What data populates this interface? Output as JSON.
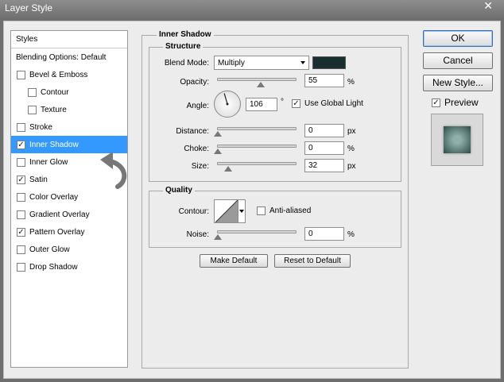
{
  "window": {
    "title": "Layer Style",
    "close_glyph": "✕"
  },
  "styles_panel": {
    "header": "Styles",
    "items": [
      {
        "label": "Blending Options: Default",
        "has_checkbox": false,
        "checked": false,
        "indent": false,
        "selected": false
      },
      {
        "label": "Bevel & Emboss",
        "has_checkbox": true,
        "checked": false,
        "indent": false,
        "selected": false
      },
      {
        "label": "Contour",
        "has_checkbox": true,
        "checked": false,
        "indent": true,
        "selected": false
      },
      {
        "label": "Texture",
        "has_checkbox": true,
        "checked": false,
        "indent": true,
        "selected": false
      },
      {
        "label": "Stroke",
        "has_checkbox": true,
        "checked": false,
        "indent": false,
        "selected": false
      },
      {
        "label": "Inner Shadow",
        "has_checkbox": true,
        "checked": true,
        "indent": false,
        "selected": true
      },
      {
        "label": "Inner Glow",
        "has_checkbox": true,
        "checked": false,
        "indent": false,
        "selected": false
      },
      {
        "label": "Satin",
        "has_checkbox": true,
        "checked": true,
        "indent": false,
        "selected": false
      },
      {
        "label": "Color Overlay",
        "has_checkbox": true,
        "checked": false,
        "indent": false,
        "selected": false
      },
      {
        "label": "Gradient Overlay",
        "has_checkbox": true,
        "checked": false,
        "indent": false,
        "selected": false
      },
      {
        "label": "Pattern Overlay",
        "has_checkbox": true,
        "checked": true,
        "indent": false,
        "selected": false
      },
      {
        "label": "Outer Glow",
        "has_checkbox": true,
        "checked": false,
        "indent": false,
        "selected": false
      },
      {
        "label": "Drop Shadow",
        "has_checkbox": true,
        "checked": false,
        "indent": false,
        "selected": false
      }
    ]
  },
  "inner_shadow": {
    "section_title": "Inner Shadow",
    "structure_title": "Structure",
    "blend_mode": {
      "label": "Blend Mode:",
      "value": "Multiply",
      "color": "#1a2e30"
    },
    "opacity": {
      "label": "Opacity:",
      "value": "55",
      "unit": "%",
      "level": 0.55
    },
    "angle": {
      "label": "Angle:",
      "value": "106",
      "unit": "°",
      "degrees": 106,
      "use_global_light_label": "Use Global Light",
      "use_global_light": true
    },
    "distance": {
      "label": "Distance:",
      "value": "0",
      "unit": "px",
      "level": 0
    },
    "choke": {
      "label": "Choke:",
      "value": "0",
      "unit": "%",
      "level": 0
    },
    "size": {
      "label": "Size:",
      "value": "32",
      "unit": "px",
      "level": 0.128
    },
    "quality_title": "Quality",
    "contour": {
      "label": "Contour:",
      "anti_aliased_label": "Anti-aliased",
      "anti_aliased": false
    },
    "noise": {
      "label": "Noise:",
      "value": "0",
      "unit": "%",
      "level": 0
    },
    "make_default_label": "Make Default",
    "reset_default_label": "Reset to Default"
  },
  "actions": {
    "ok_label": "OK",
    "cancel_label": "Cancel",
    "new_style_label": "New Style...",
    "preview_label": "Preview",
    "preview_checked": true
  },
  "colors": {
    "selection": "#3399ff",
    "dialog_bg": "#ececec"
  }
}
